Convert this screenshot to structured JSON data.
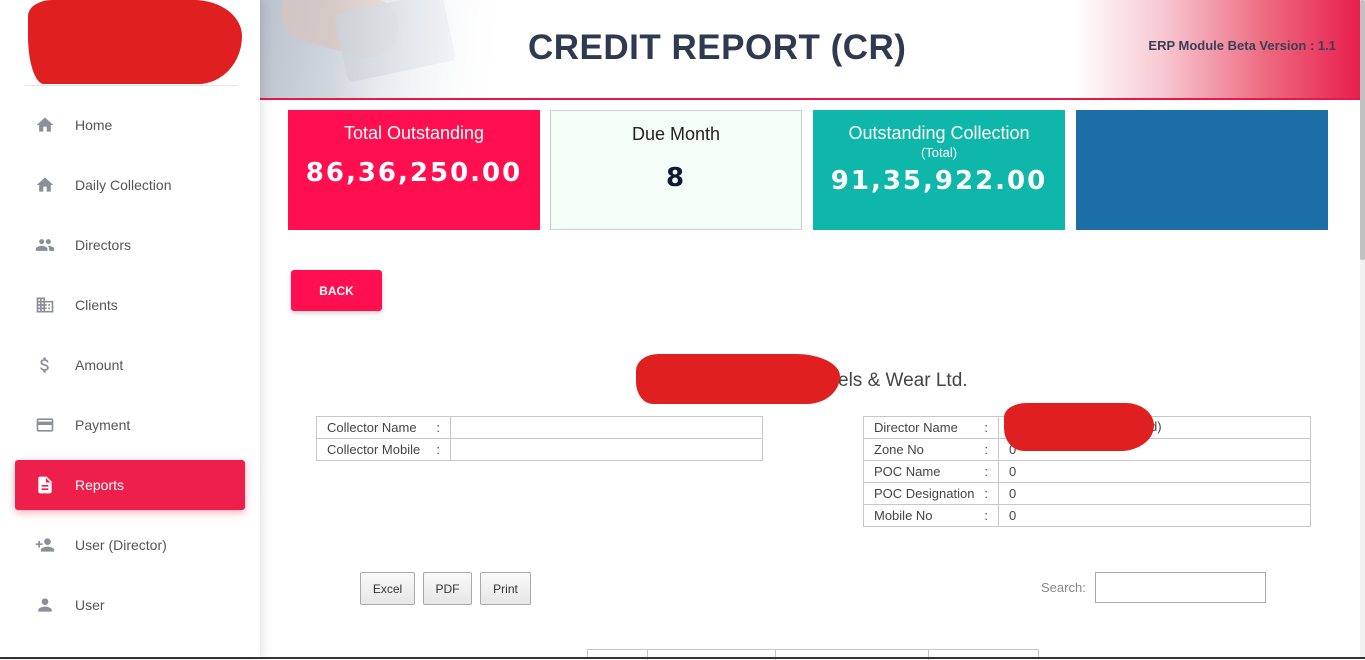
{
  "sidebar": {
    "items": [
      {
        "label": "Home",
        "icon": "home-icon",
        "active": false
      },
      {
        "label": "Daily Collection",
        "icon": "home-icon",
        "active": false
      },
      {
        "label": "Directors",
        "icon": "people-icon",
        "active": false
      },
      {
        "label": "Clients",
        "icon": "building-icon",
        "active": false
      },
      {
        "label": "Amount",
        "icon": "dollar-icon",
        "active": false
      },
      {
        "label": "Payment",
        "icon": "credit-card-icon",
        "active": false
      },
      {
        "label": "Reports",
        "icon": "document-icon",
        "active": true
      },
      {
        "label": "User (Director)",
        "icon": "add-user-icon",
        "active": false
      },
      {
        "label": "User",
        "icon": "person-icon",
        "active": false
      }
    ]
  },
  "header": {
    "title": "CREDIT REPORT (CR)",
    "version": "ERP Module Beta Version : 1.1"
  },
  "cards": {
    "total_outstanding": {
      "title": "Total Outstanding",
      "value": "86,36,250.00"
    },
    "due_month": {
      "title": "Due Month",
      "value": "8"
    },
    "outstanding_collection": {
      "title": "Outstanding Collection",
      "subtitle": "(Total)",
      "value": "91,35,922.00"
    }
  },
  "back_label": "BACK",
  "company_visible": "els & Wear Ltd.",
  "collector": {
    "name_label": "Collector Name",
    "name_value": "",
    "mobile_label": "Collector Mobile",
    "mobile_value": ""
  },
  "director": {
    "name_label": "Director Name",
    "name_tail": "d)",
    "zone_label": "Zone No",
    "zone_value": "0",
    "poc_name_label": "POC Name",
    "poc_name_value": "0",
    "poc_designation_label": "POC Designation",
    "poc_designation_value": "0",
    "mobile_label": "Mobile No",
    "mobile_value": "0"
  },
  "colon": ":",
  "export": {
    "excel": "Excel",
    "pdf": "PDF",
    "print": "Print"
  },
  "search": {
    "label": "Search:",
    "value": ""
  },
  "colors": {
    "accent": "#ff0f4f",
    "teal": "#0eb7a9",
    "blue": "#1b6fa6",
    "sidebar_active": "#ef1f4b"
  }
}
